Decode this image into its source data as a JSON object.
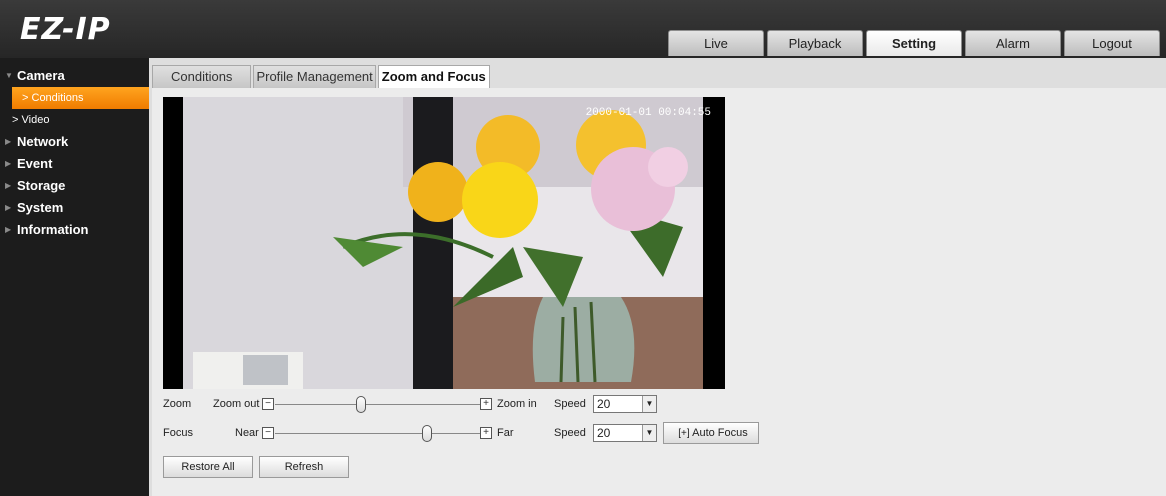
{
  "logo": {
    "text": "EZ-IP"
  },
  "nav": {
    "tabs": [
      {
        "label": "Live"
      },
      {
        "label": "Playback"
      },
      {
        "label": "Setting"
      },
      {
        "label": "Alarm"
      },
      {
        "label": "Logout"
      }
    ],
    "active": "Setting"
  },
  "sidebar": {
    "camera": "Camera",
    "conditions": "Conditions",
    "video": "Video",
    "network": "Network",
    "event": "Event",
    "storage": "Storage",
    "system": "System",
    "information": "Information"
  },
  "subtabs": {
    "conditions": "Conditions",
    "profile": "Profile Management",
    "zoom_focus": "Zoom and Focus"
  },
  "video": {
    "timestamp": "2000-01-01 00:04:55"
  },
  "zoom": {
    "label": "Zoom",
    "out_label": "Zoom out",
    "in_label": "Zoom in",
    "level": 0.42,
    "speed_label": "Speed",
    "speed_value": "20"
  },
  "focus": {
    "label": "Focus",
    "near_label": "Near",
    "far_label": "Far",
    "level": 0.74,
    "speed_label": "Speed",
    "speed_value": "20",
    "auto_focus_label": "Auto Focus"
  },
  "buttons": {
    "restore_all": "Restore All",
    "refresh": "Refresh"
  },
  "colors": {
    "accent": "#f58a0b",
    "topbar": "#2e2e2e",
    "sidebar": "#1c1c1c"
  }
}
